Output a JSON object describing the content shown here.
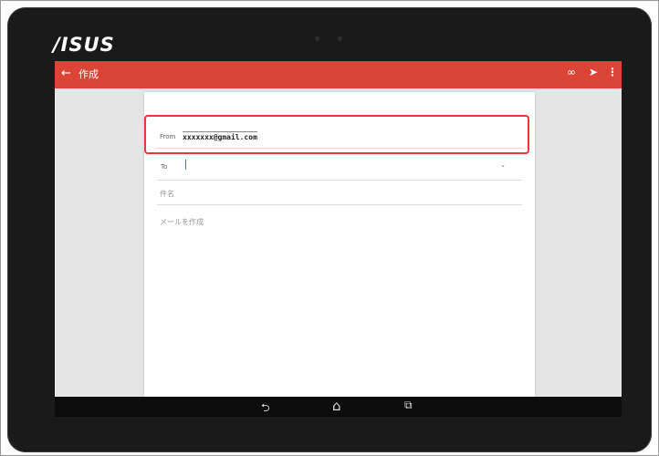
{
  "device": {
    "brand": "/ISUS"
  },
  "appbar": {
    "back_icon": "arrow-back-icon",
    "title": "作成",
    "actions": [
      "attachment-icon",
      "send-icon",
      "more-vert-icon"
    ]
  },
  "compose": {
    "from_label": "From",
    "from_value": "xxxxxxx@gmail.com",
    "to_label": "To",
    "to_value": "",
    "to_dropdown_icon": "chevron-down-icon",
    "subject_placeholder": "件名",
    "body_placeholder": "メールを作成"
  },
  "navbar": {
    "icons": [
      "nav-back-icon",
      "nav-home-icon",
      "nav-recents-icon"
    ]
  },
  "colors": {
    "appbar": "#db4437",
    "highlight": "#e23b3b",
    "cursor": "#4a6fd1"
  }
}
